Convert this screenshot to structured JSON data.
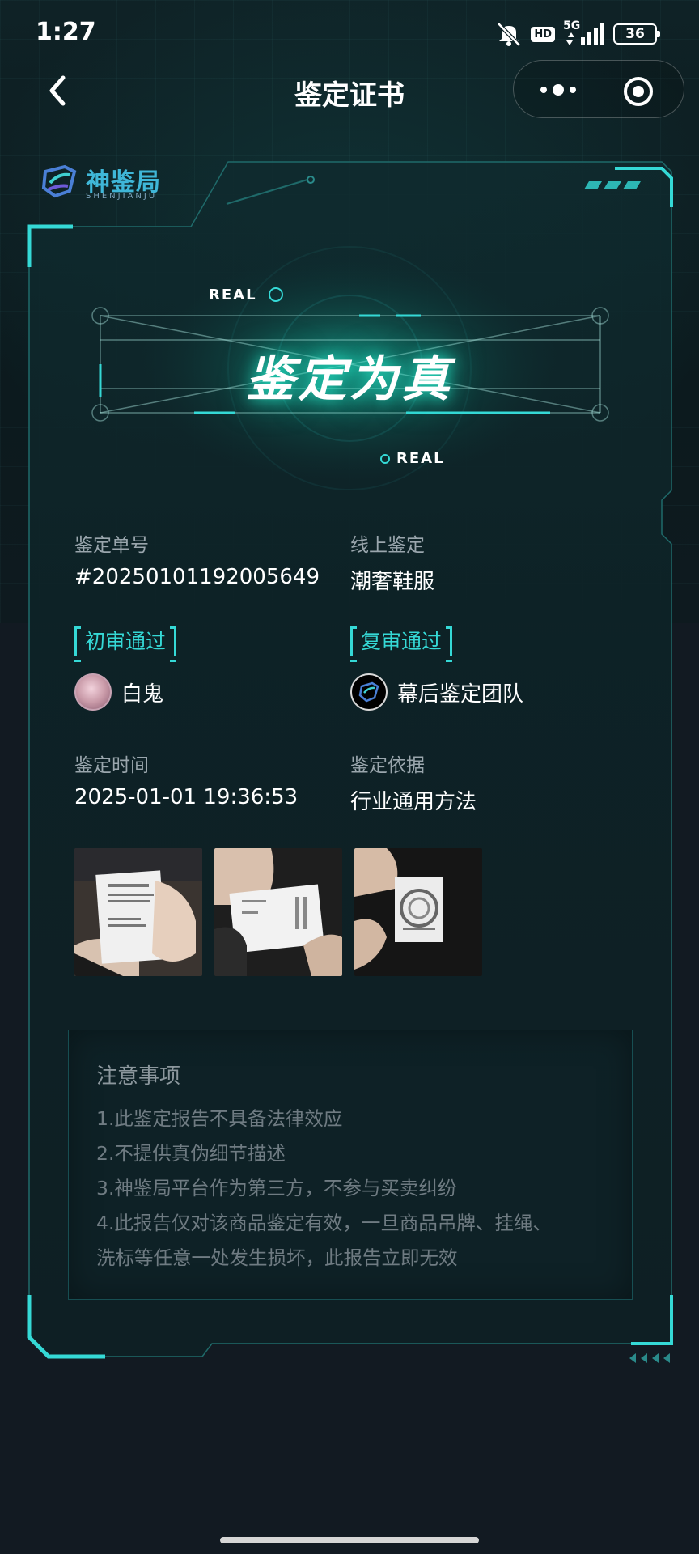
{
  "status_bar": {
    "time": "1:27",
    "hd": "HD",
    "network": "5G",
    "battery": "36"
  },
  "nav": {
    "title": "鉴定证书"
  },
  "logo": {
    "name": "神鉴局",
    "sub": "SHENJIANJU"
  },
  "hero": {
    "real_top": "REAL",
    "verdict": "鉴定为真",
    "real_bottom": "REAL"
  },
  "info": {
    "order_label": "鉴定单号",
    "order_value": "#20250101192005649",
    "type_label": "线上鉴定",
    "type_value": "潮奢鞋服",
    "first_review_tag": "初审通过",
    "first_reviewer": "白鬼",
    "second_review_tag": "复审通过",
    "second_reviewer": "幕后鉴定团队",
    "time_label": "鉴定时间",
    "time_value": "2025-01-01 19:36:53",
    "basis_label": "鉴定依据",
    "basis_value": "行业通用方法"
  },
  "notice": {
    "title": "注意事项",
    "items": [
      "1.此鉴定报告不具备法律效应",
      "2.不提供真伪细节描述",
      "3.神鉴局平台作为第三方，不参与买卖纠纷",
      "4.此报告仅对该商品鉴定有效，一旦商品吊牌、挂绳、",
      "洗标等任意一处发生损坏，此报告立即无效"
    ]
  },
  "colors": {
    "accent": "#35d9d6",
    "background": "#111820",
    "card": "#0e2227"
  }
}
